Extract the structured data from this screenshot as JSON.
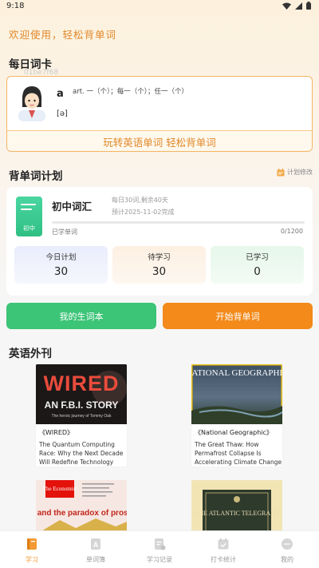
{
  "status_bar": {
    "time": "9:18"
  },
  "welcome": "欢迎使用，轻松背单词",
  "daily_card": {
    "section_title": "每日词卡",
    "faint_id": "01be7f68",
    "word": "a",
    "definition": "art. 一（个）；每一（个）；任一（个）",
    "phonetic": "[ə]",
    "slogan": "玩转英语单词 轻松背单词"
  },
  "plan": {
    "section_title": "背单词计划",
    "edit_label": "计划修改",
    "book_label": "初中",
    "name": "初中词汇",
    "info_daily": "每日30词,剩余40天",
    "info_eta": "预计2025-11-02完成",
    "learned_label": "已学单词",
    "learned_count": "0/1200",
    "progress": 0,
    "stats": [
      {
        "label": "今日计划",
        "value": "30"
      },
      {
        "label": "待学习",
        "value": "30"
      },
      {
        "label": "已学习",
        "value": "0"
      }
    ]
  },
  "buttons": {
    "wordbook": "我的生词本",
    "start": "开始背单词"
  },
  "magazines": {
    "section_title": "英语外刊",
    "items": [
      {
        "title": "《WIRED》",
        "desc": "The Quantum Computing Race: Why the Next Decade Will Redefine Technology",
        "cover_main": "WIRED",
        "cover_story": "AN F.B.I. STORY",
        "cover_small": "The heroic journey of Tommy Oak"
      },
      {
        "title": "《National Geographic》",
        "desc": "The Great Thaw: How Permafrost Collapse Is Accelerating Climate Change",
        "cover_main": "NATIONAL GEOGRAPHIC"
      },
      {
        "cover_brand": "The Economist",
        "cover_headline": "China and the paradox of prosperity"
      },
      {
        "cover_main": "THE ATLANTIC TELEGRAPH"
      }
    ]
  },
  "tabs": [
    {
      "label": "学习",
      "icon": "book-icon",
      "active": true
    },
    {
      "label": "单词簿",
      "icon": "letter-a-icon",
      "active": false
    },
    {
      "label": "学习记录",
      "icon": "record-icon",
      "active": false
    },
    {
      "label": "打卡统计",
      "icon": "calendar-check-icon",
      "active": false
    },
    {
      "label": "我的",
      "icon": "profile-icon",
      "active": false
    }
  ],
  "colors": {
    "accent_orange": "#f38a1a",
    "accent_green": "#3cc477",
    "welcome_text": "#e0882a"
  }
}
